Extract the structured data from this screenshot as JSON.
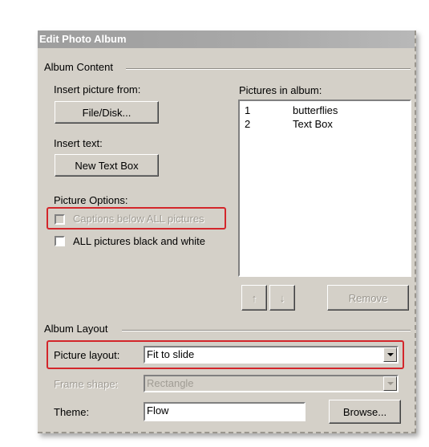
{
  "dialog": {
    "title": "Edit Photo Album",
    "album_content": {
      "label": "Album Content",
      "insert_picture_label": "Insert picture from:",
      "file_disk_button": "File/Disk...",
      "insert_text_label": "Insert text:",
      "new_text_box_button": "New Text Box",
      "picture_options_label": "Picture Options:",
      "captions_checkbox": "Captions below ALL pictures",
      "black_white_checkbox": "ALL pictures black and white",
      "pictures_in_album_label": "Pictures in album:",
      "pictures": [
        {
          "num": "1",
          "name": "butterflies"
        },
        {
          "num": "2",
          "name": "Text Box"
        }
      ],
      "move_up_icon": "↑",
      "move_down_icon": "↓",
      "remove_button": "Remove"
    },
    "album_layout": {
      "label": "Album Layout",
      "picture_layout_label": "Picture layout:",
      "picture_layout_value": "Fit to slide",
      "frame_shape_label": "Frame shape:",
      "frame_shape_value": "Rectangle",
      "theme_label": "Theme:",
      "theme_value": "Flow",
      "browse_button": "Browse..."
    }
  },
  "colors": {
    "dialog_bg": "#d4d0c8",
    "highlight": "#d3262b"
  }
}
